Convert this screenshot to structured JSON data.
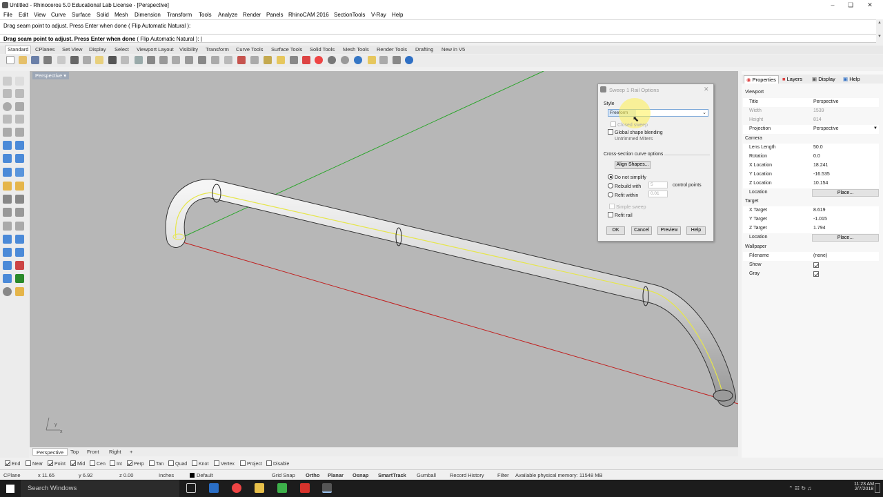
{
  "window": {
    "title": "Untitled - Rhinoceros 5.0 Educational Lab License - [Perspective]"
  },
  "menu": [
    "File",
    "Edit",
    "View",
    "Curve",
    "Surface",
    "Solid",
    "Mesh",
    "Dimension",
    "Transform",
    "Tools",
    "Analyze",
    "Render",
    "Panels",
    "RhinoCAM 2016",
    "SectionTools",
    "V-Ray",
    "Help"
  ],
  "command": {
    "history_line": "Drag seam point to adjust. Press Enter when done ( Flip  Automatic  Natural ):",
    "prompt": "Drag seam point to adjust. Press Enter when done",
    "options": "( Flip  Automatic  Natural ):"
  },
  "toolbar_tabs": [
    "Standard",
    "CPlanes",
    "Set View",
    "Display",
    "Select",
    "Viewport Layout",
    "Visibility",
    "Transform",
    "Curve Tools",
    "Surface Tools",
    "Solid Tools",
    "Mesh Tools",
    "Render Tools",
    "Drafting",
    "New in V5"
  ],
  "viewport": {
    "name": "Perspective",
    "axis_x": "x",
    "axis_y": "y"
  },
  "view_tabs": [
    "Perspective",
    "Top",
    "Front",
    "Right"
  ],
  "dialog": {
    "title": "Sweep 1 Rail Options",
    "style_label": "Style",
    "style_value": "Freeform",
    "closed_sweep": "Closed sweep",
    "global_blending": "Global shape blending",
    "untrimmed_miters": "Untrimmed Miters",
    "cross_section_label": "Cross-section curve options",
    "align_shapes": "Align Shapes...",
    "do_not_simplify": "Do not simplify",
    "rebuild_with": "Rebuild with",
    "rebuild_value": "5",
    "control_points": "control points",
    "refit_within": "Refit within",
    "refit_value": "0.01",
    "simple_sweep": "Simple sweep",
    "refit_rail": "Refit rail",
    "ok": "OK",
    "cancel": "Cancel",
    "preview": "Preview",
    "help": "Help"
  },
  "panel_tabs": [
    "Properties",
    "Layers",
    "Display",
    "Help"
  ],
  "properties": {
    "viewport_header": "Viewport",
    "rows": [
      {
        "k": "Title",
        "v": "Perspective"
      },
      {
        "k": "Width",
        "v": "1539"
      },
      {
        "k": "Height",
        "v": "814"
      },
      {
        "k": "Projection",
        "v": "Perspective"
      }
    ],
    "camera_header": "Camera",
    "camera": [
      {
        "k": "Lens Length",
        "v": "50.0"
      },
      {
        "k": "Rotation",
        "v": "0.0"
      },
      {
        "k": "X Location",
        "v": "18.241"
      },
      {
        "k": "Y Location",
        "v": "-16.535"
      },
      {
        "k": "Z Location",
        "v": "10.154"
      },
      {
        "k": "Location",
        "v": "Place..."
      }
    ],
    "target_header": "Target",
    "target": [
      {
        "k": "X Target",
        "v": "8.619"
      },
      {
        "k": "Y Target",
        "v": "-1.015"
      },
      {
        "k": "Z Target",
        "v": "1.794"
      },
      {
        "k": "Location",
        "v": "Place..."
      }
    ],
    "wallpaper_header": "Wallpaper",
    "wallpaper": [
      {
        "k": "Filename",
        "v": "(none)"
      },
      {
        "k": "Show",
        "v": ""
      },
      {
        "k": "Gray",
        "v": ""
      }
    ]
  },
  "osnaps": [
    {
      "label": "End",
      "on": true
    },
    {
      "label": "Near",
      "on": false
    },
    {
      "label": "Point",
      "on": true
    },
    {
      "label": "Mid",
      "on": true
    },
    {
      "label": "Cen",
      "on": false
    },
    {
      "label": "Int",
      "on": false
    },
    {
      "label": "Perp",
      "on": true
    },
    {
      "label": "Tan",
      "on": false
    },
    {
      "label": "Quad",
      "on": false
    },
    {
      "label": "Knot",
      "on": false
    },
    {
      "label": "Vertex",
      "on": false
    },
    {
      "label": "Project",
      "on": false
    },
    {
      "label": "Disable",
      "on": false
    }
  ],
  "status": {
    "cplane": "CPlane",
    "x": "x 11.65",
    "y": "y 6.92",
    "z": "z 0.00",
    "units": "Inches",
    "layer": "Default",
    "grid_snap": "Grid Snap",
    "ortho": "Ortho",
    "planar": "Planar",
    "osnap": "Osnap",
    "smarttrack": "SmartTrack",
    "gumball": "Gumball",
    "record_history": "Record History",
    "filter": "Filter",
    "memory": "Available physical memory: 11548 MB"
  },
  "taskbar": {
    "search": "Search Windows",
    "time": "11:23 AM",
    "date": "2/7/2018"
  },
  "colors": {
    "viewport_bg": "#b7b7b7",
    "x_axis": "#c0201f",
    "y_axis": "#2aa52a",
    "rail": "#e6e64a",
    "accent": "#0078d7"
  }
}
